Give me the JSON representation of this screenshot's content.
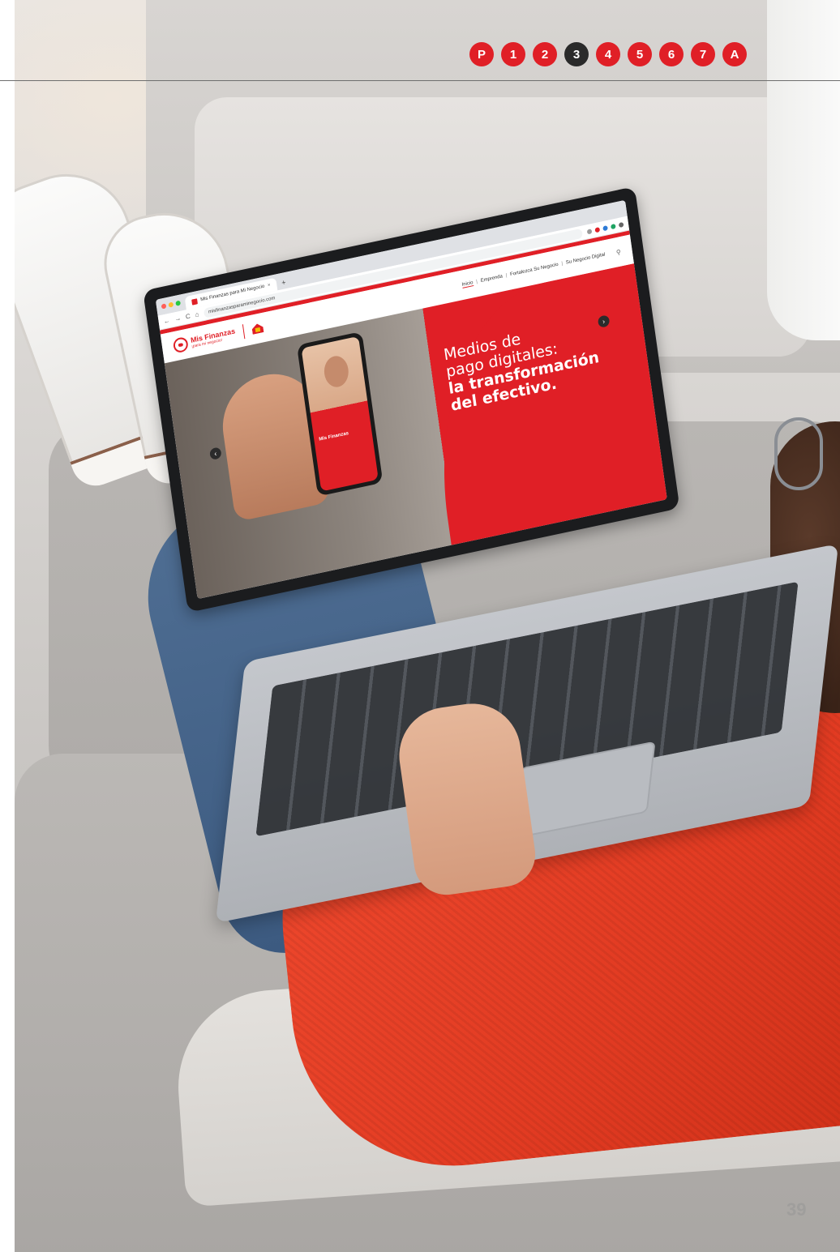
{
  "chapter_nav": {
    "items": [
      "P",
      "1",
      "2",
      "3",
      "4",
      "5",
      "6",
      "7",
      "A"
    ],
    "active": "3",
    "accent_color": "#e01f26",
    "active_color": "#2a2a2a"
  },
  "page_number": "39",
  "browser": {
    "tab_title": "Mis Finanzas para Mi Negocio",
    "tab_close": "×",
    "new_tab": "+",
    "nav_back": "←",
    "nav_forward": "→",
    "nav_reload": "C",
    "nav_home": "⌂",
    "url": "misfinanzasparaminegocio.com"
  },
  "site": {
    "logo_title": "Mis Finanzas",
    "logo_subtitle": "¡para mi negocio!",
    "nav": [
      "Inicio",
      "Emprenda",
      "Fortalezca Su Negocio",
      "Su Negocio Digital"
    ],
    "nav_separator": "|",
    "brand_color": "#e01f26"
  },
  "hero": {
    "line1": "Medios de",
    "line2": "pago digitales:",
    "line3": "la transformación",
    "line4": "del efectivo.",
    "phone_logo": "Mis Finanzas",
    "prev_icon": "‹",
    "next_icon": "›"
  }
}
